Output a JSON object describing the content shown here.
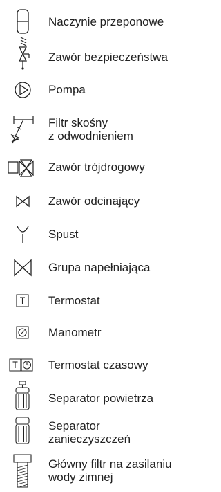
{
  "legend": {
    "items": [
      {
        "icon": "expansion-vessel-icon",
        "label": "Naczynie przeponowe"
      },
      {
        "icon": "safety-valve-icon",
        "label": "Zawór bezpieczeństwa"
      },
      {
        "icon": "pump-icon",
        "label": "Pompa"
      },
      {
        "icon": "angled-filter-with-drain-icon",
        "label": "Filtr skośny\nz odwodnieniem"
      },
      {
        "icon": "three-way-valve-icon",
        "label": "Zawór trójdrogowy"
      },
      {
        "icon": "shut-off-valve-icon",
        "label": "Zawór odcinający"
      },
      {
        "icon": "drain-icon",
        "label": "Spust"
      },
      {
        "icon": "filling-group-icon",
        "label": "Grupa napełniająca"
      },
      {
        "icon": "thermostat-icon",
        "label": "Termostat"
      },
      {
        "icon": "pressure-gauge-icon",
        "label": "Manometr"
      },
      {
        "icon": "timer-thermostat-icon",
        "label": "Termostat czasowy"
      },
      {
        "icon": "air-separator-icon",
        "label": "Separator powietrza"
      },
      {
        "icon": "dirt-separator-icon",
        "label": "Separator\nzanieczyszczeń"
      },
      {
        "icon": "main-cold-water-filter-icon",
        "label": "Główny filtr na zasilaniu\nwody zimnej"
      }
    ]
  },
  "colors": {
    "text": "#222222",
    "stroke": "#222222"
  }
}
